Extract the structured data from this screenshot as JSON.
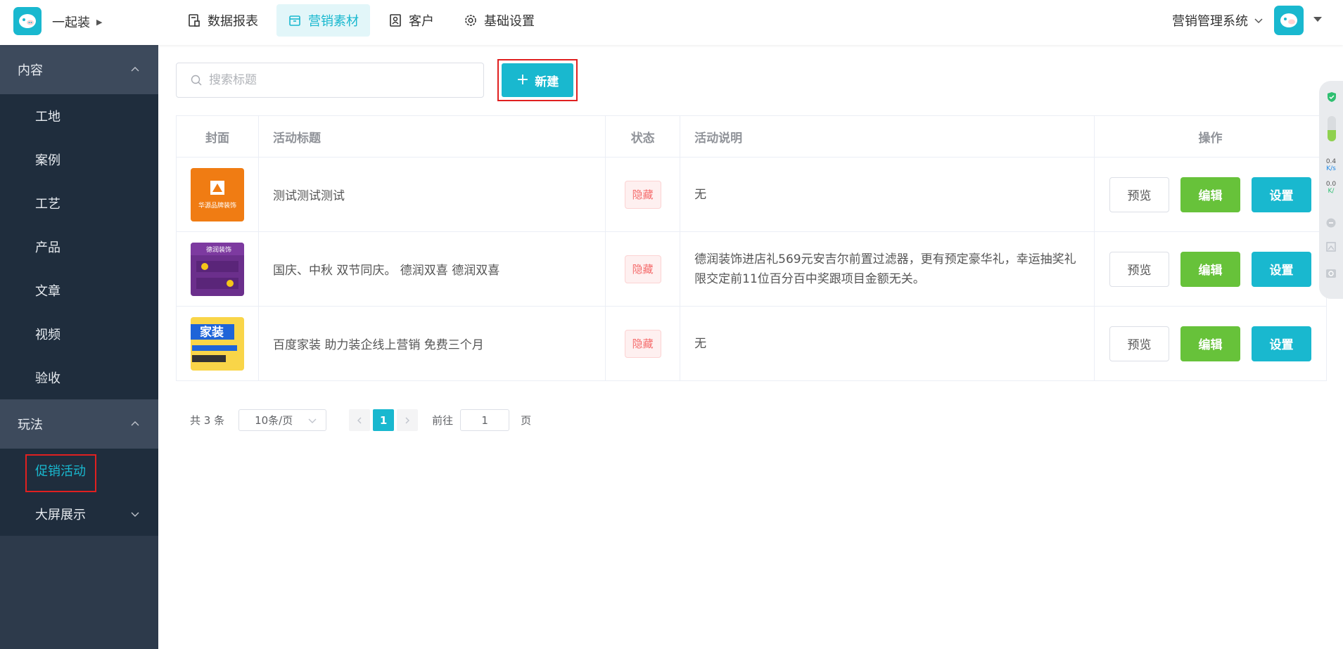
{
  "header": {
    "brand": "一起装",
    "nav": [
      {
        "label": "数据报表",
        "icon": "report-icon",
        "active": false
      },
      {
        "label": "营销素材",
        "icon": "box-icon",
        "active": true
      },
      {
        "label": "客户",
        "icon": "contact-icon",
        "active": false
      },
      {
        "label": "基础设置",
        "icon": "gear-icon",
        "active": false
      }
    ],
    "system": "营销管理系统"
  },
  "sidebar": {
    "groups": [
      {
        "title": "内容",
        "items": [
          "工地",
          "案例",
          "工艺",
          "产品",
          "文章",
          "视频",
          "验收"
        ]
      },
      {
        "title": "玩法",
        "items": [
          "促销活动",
          "大屏展示"
        ]
      }
    ]
  },
  "toolbar": {
    "search_placeholder": "搜索标题",
    "new_label": "新建"
  },
  "table": {
    "headers": [
      "封面",
      "活动标题",
      "状态",
      "活动说明",
      "操作"
    ],
    "rows": [
      {
        "title": "测试测试测试",
        "status": "隐藏",
        "desc": "无"
      },
      {
        "title": "国庆、中秋 双节同庆。 德润双喜 德润双喜",
        "status": "隐藏",
        "desc": "德润装饰进店礼569元安吉尔前置过滤器，更有预定豪华礼，幸运抽奖礼限交定前11位百分百中奖跟项目金额无关。"
      },
      {
        "title": "百度家装 助力装企线上营销 免费三个月",
        "status": "隐藏",
        "desc": "无"
      }
    ],
    "actions": {
      "preview": "预览",
      "edit": "编辑",
      "settings": "设置"
    }
  },
  "thumbs": [
    "华源品牌装饰",
    "德润装饰",
    "家装"
  ],
  "pagination": {
    "total": "共 3 条",
    "page_size": "10条/页",
    "current": "1",
    "goto_label": "前往",
    "goto_value": "1",
    "page_suffix": "页"
  },
  "widget": {
    "up": "0.4",
    "up_unit": "K/s",
    "down": "0.0",
    "down_unit": "K/"
  },
  "colors": {
    "primary": "#19b8cf",
    "success": "#67c23a",
    "danger": "#f56c6c",
    "sidebar": "#2d3a4b"
  }
}
